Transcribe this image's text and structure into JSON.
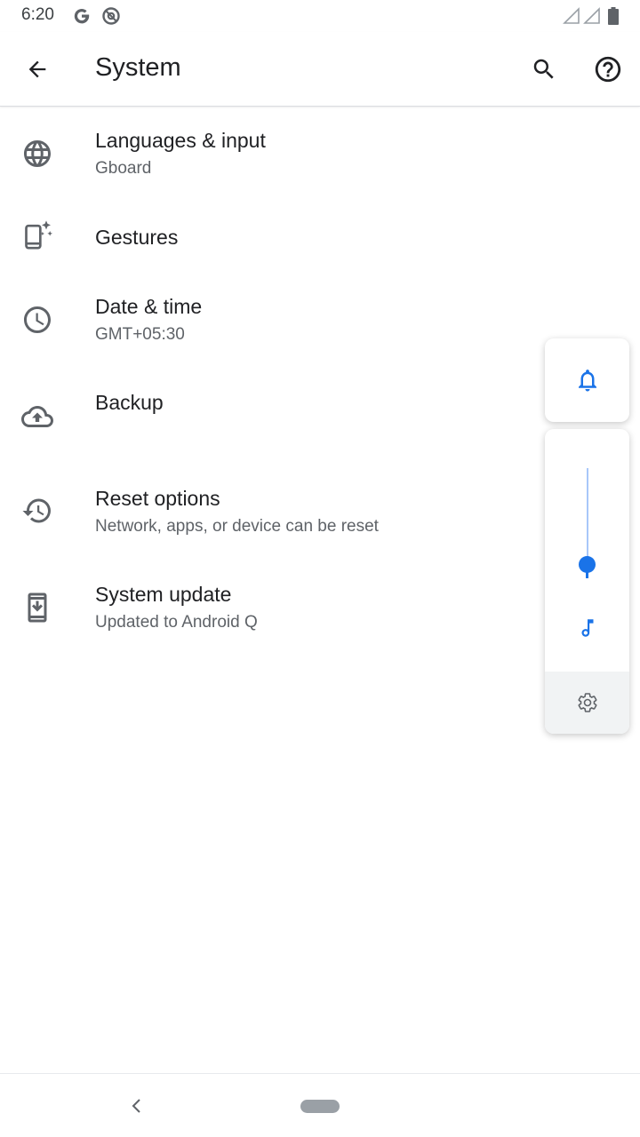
{
  "status_bar": {
    "time": "6:20",
    "icons": [
      "google-g-icon",
      "at-sign-icon",
      "signal-empty-icon",
      "signal-empty-icon",
      "battery-icon"
    ]
  },
  "app_bar": {
    "title": "System",
    "back_icon": "arrow-back-icon",
    "search_icon": "search-icon",
    "help_icon": "help-circle-icon"
  },
  "settings": [
    {
      "title": "Languages & input",
      "summary": "Gboard",
      "icon": "globe-icon"
    },
    {
      "title": "Gestures",
      "summary": "",
      "icon": "phone-gesture-icon"
    },
    {
      "title": "Date & time",
      "summary": "GMT+05:30",
      "icon": "clock-icon"
    },
    {
      "title": "Backup",
      "summary": "",
      "icon": "cloud-upload-icon"
    },
    {
      "title": "Reset options",
      "summary": "Network, apps, or device can be reset",
      "icon": "history-icon"
    },
    {
      "title": "System update",
      "summary": "Updated to Android Q",
      "icon": "system-update-icon"
    }
  ],
  "volume_panel": {
    "ringer_icon": "bell-icon",
    "music_icon": "music-note-icon",
    "settings_icon": "gear-icon",
    "level": 0.13
  },
  "colors": {
    "accent": "#1a73e8",
    "text_primary": "#202124",
    "text_secondary": "#5f6368",
    "icon": "#5f6368"
  },
  "nav_bar": {
    "back_icon": "nav-back-chevron-icon",
    "home_icon": "home-pill-icon"
  }
}
